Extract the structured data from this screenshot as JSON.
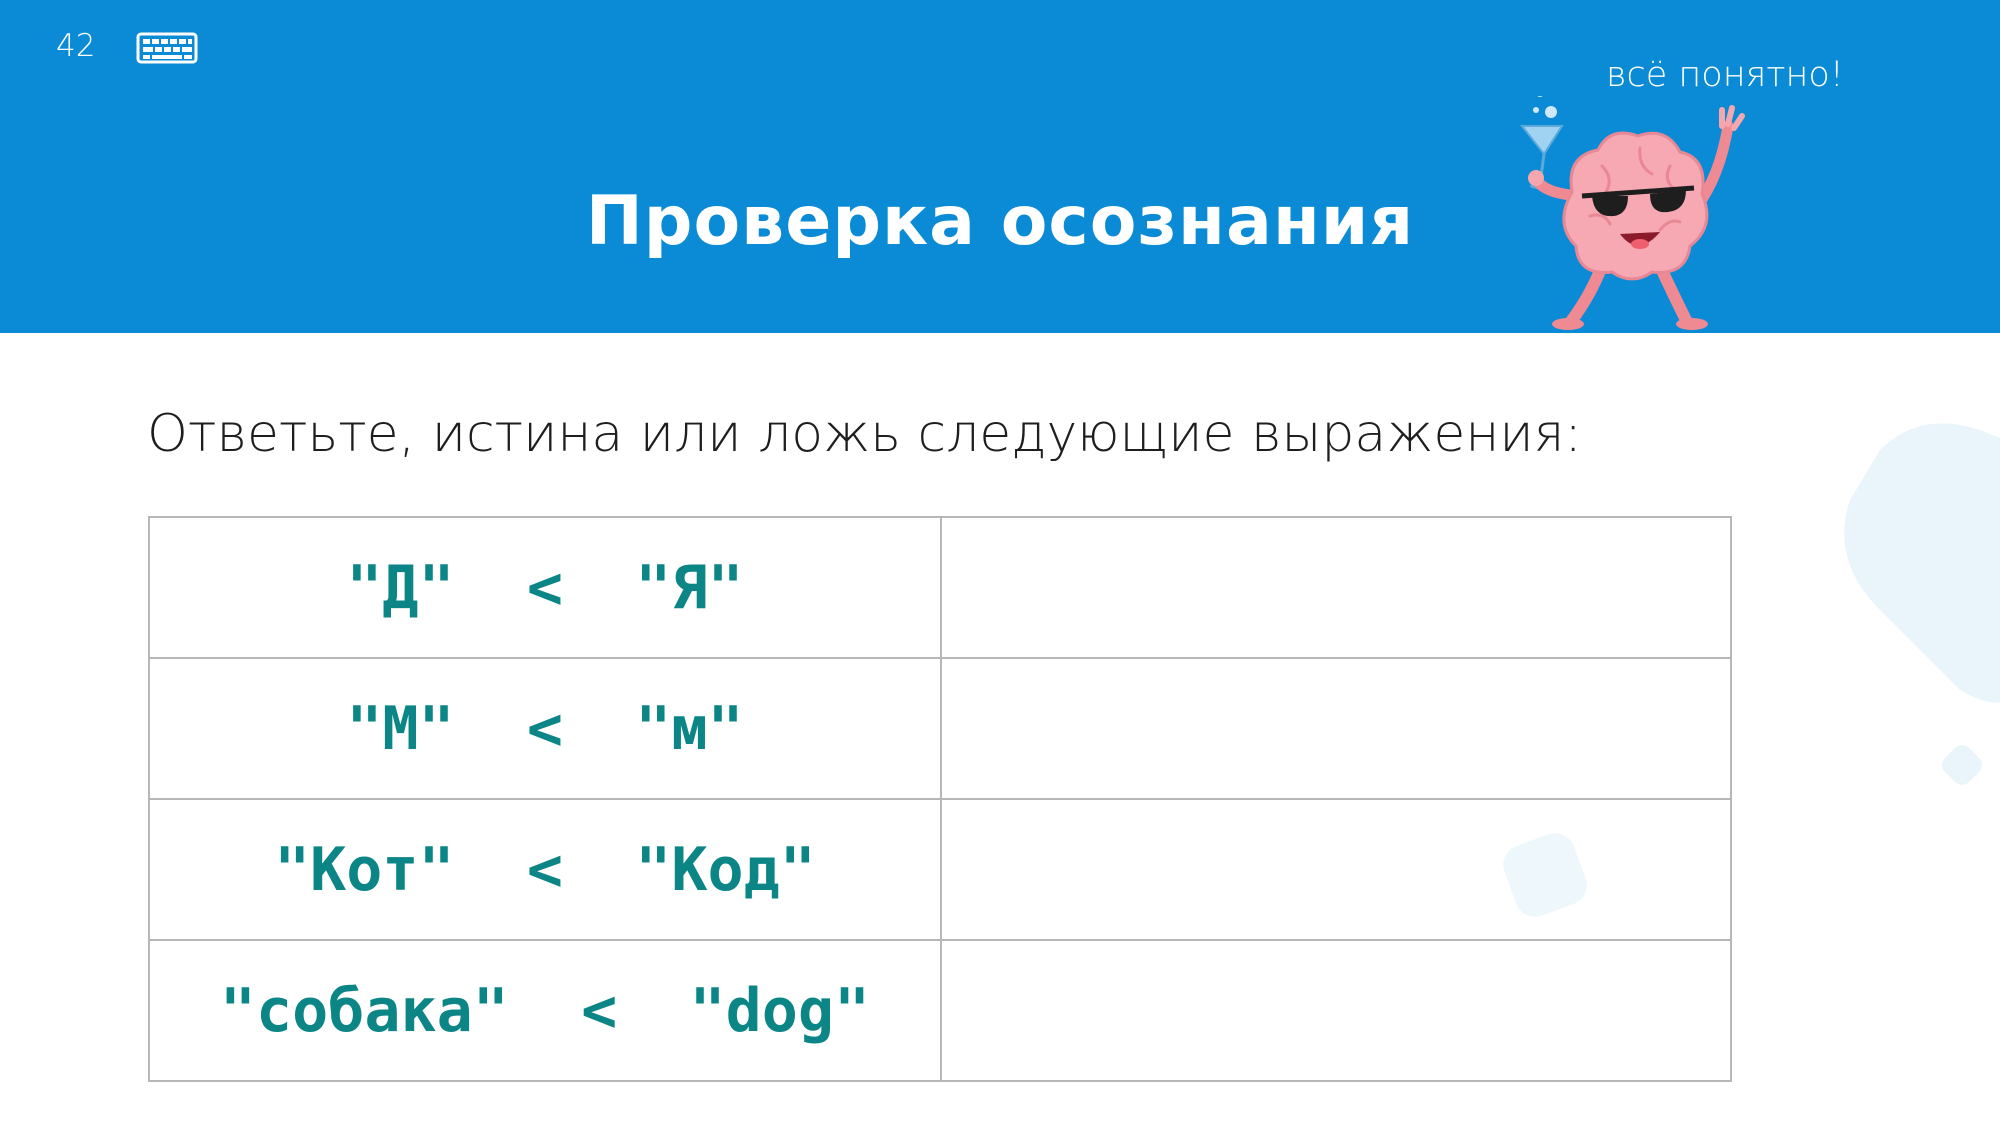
{
  "slide": {
    "number": "42",
    "title": "Проверка осознания",
    "mascot_caption": "всё понятно!"
  },
  "content": {
    "question": "Ответьте, истина или ложь следующие выражения:",
    "rows": [
      {
        "expression": "\"Д\"  <  \"Я\"",
        "answer": ""
      },
      {
        "expression": "\"М\"  <  \"м\"",
        "answer": ""
      },
      {
        "expression": "\"Кот\"  <  \"Код\"",
        "answer": ""
      },
      {
        "expression": "\"собака\"  <  \"dog\"",
        "answer": ""
      }
    ]
  },
  "icons": {
    "keyboard": "keyboard-icon",
    "mascot": "brain-mascot-icon"
  },
  "colors": {
    "header": "#0b8bd6",
    "expression": "#0b8585",
    "table_border": "#b7b7b7",
    "decoration": "#eaf5fb"
  }
}
